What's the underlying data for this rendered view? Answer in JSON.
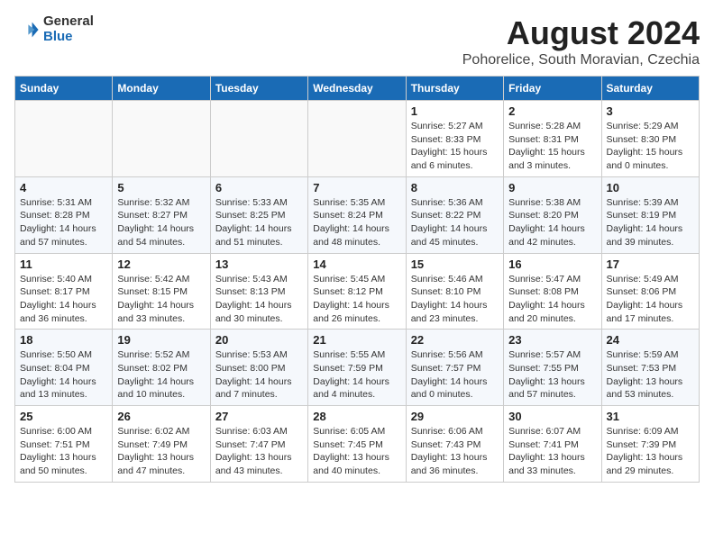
{
  "header": {
    "logo_line1": "General",
    "logo_line2": "Blue",
    "title": "August 2024",
    "subtitle": "Pohorelice, South Moravian, Czechia"
  },
  "days_of_week": [
    "Sunday",
    "Monday",
    "Tuesday",
    "Wednesday",
    "Thursday",
    "Friday",
    "Saturday"
  ],
  "weeks": [
    [
      {
        "day": "",
        "info": ""
      },
      {
        "day": "",
        "info": ""
      },
      {
        "day": "",
        "info": ""
      },
      {
        "day": "",
        "info": ""
      },
      {
        "day": "1",
        "info": "Sunrise: 5:27 AM\nSunset: 8:33 PM\nDaylight: 15 hours and 6 minutes."
      },
      {
        "day": "2",
        "info": "Sunrise: 5:28 AM\nSunset: 8:31 PM\nDaylight: 15 hours and 3 minutes."
      },
      {
        "day": "3",
        "info": "Sunrise: 5:29 AM\nSunset: 8:30 PM\nDaylight: 15 hours and 0 minutes."
      }
    ],
    [
      {
        "day": "4",
        "info": "Sunrise: 5:31 AM\nSunset: 8:28 PM\nDaylight: 14 hours and 57 minutes."
      },
      {
        "day": "5",
        "info": "Sunrise: 5:32 AM\nSunset: 8:27 PM\nDaylight: 14 hours and 54 minutes."
      },
      {
        "day": "6",
        "info": "Sunrise: 5:33 AM\nSunset: 8:25 PM\nDaylight: 14 hours and 51 minutes."
      },
      {
        "day": "7",
        "info": "Sunrise: 5:35 AM\nSunset: 8:24 PM\nDaylight: 14 hours and 48 minutes."
      },
      {
        "day": "8",
        "info": "Sunrise: 5:36 AM\nSunset: 8:22 PM\nDaylight: 14 hours and 45 minutes."
      },
      {
        "day": "9",
        "info": "Sunrise: 5:38 AM\nSunset: 8:20 PM\nDaylight: 14 hours and 42 minutes."
      },
      {
        "day": "10",
        "info": "Sunrise: 5:39 AM\nSunset: 8:19 PM\nDaylight: 14 hours and 39 minutes."
      }
    ],
    [
      {
        "day": "11",
        "info": "Sunrise: 5:40 AM\nSunset: 8:17 PM\nDaylight: 14 hours and 36 minutes."
      },
      {
        "day": "12",
        "info": "Sunrise: 5:42 AM\nSunset: 8:15 PM\nDaylight: 14 hours and 33 minutes."
      },
      {
        "day": "13",
        "info": "Sunrise: 5:43 AM\nSunset: 8:13 PM\nDaylight: 14 hours and 30 minutes."
      },
      {
        "day": "14",
        "info": "Sunrise: 5:45 AM\nSunset: 8:12 PM\nDaylight: 14 hours and 26 minutes."
      },
      {
        "day": "15",
        "info": "Sunrise: 5:46 AM\nSunset: 8:10 PM\nDaylight: 14 hours and 23 minutes."
      },
      {
        "day": "16",
        "info": "Sunrise: 5:47 AM\nSunset: 8:08 PM\nDaylight: 14 hours and 20 minutes."
      },
      {
        "day": "17",
        "info": "Sunrise: 5:49 AM\nSunset: 8:06 PM\nDaylight: 14 hours and 17 minutes."
      }
    ],
    [
      {
        "day": "18",
        "info": "Sunrise: 5:50 AM\nSunset: 8:04 PM\nDaylight: 14 hours and 13 minutes."
      },
      {
        "day": "19",
        "info": "Sunrise: 5:52 AM\nSunset: 8:02 PM\nDaylight: 14 hours and 10 minutes."
      },
      {
        "day": "20",
        "info": "Sunrise: 5:53 AM\nSunset: 8:00 PM\nDaylight: 14 hours and 7 minutes."
      },
      {
        "day": "21",
        "info": "Sunrise: 5:55 AM\nSunset: 7:59 PM\nDaylight: 14 hours and 4 minutes."
      },
      {
        "day": "22",
        "info": "Sunrise: 5:56 AM\nSunset: 7:57 PM\nDaylight: 14 hours and 0 minutes."
      },
      {
        "day": "23",
        "info": "Sunrise: 5:57 AM\nSunset: 7:55 PM\nDaylight: 13 hours and 57 minutes."
      },
      {
        "day": "24",
        "info": "Sunrise: 5:59 AM\nSunset: 7:53 PM\nDaylight: 13 hours and 53 minutes."
      }
    ],
    [
      {
        "day": "25",
        "info": "Sunrise: 6:00 AM\nSunset: 7:51 PM\nDaylight: 13 hours and 50 minutes."
      },
      {
        "day": "26",
        "info": "Sunrise: 6:02 AM\nSunset: 7:49 PM\nDaylight: 13 hours and 47 minutes."
      },
      {
        "day": "27",
        "info": "Sunrise: 6:03 AM\nSunset: 7:47 PM\nDaylight: 13 hours and 43 minutes."
      },
      {
        "day": "28",
        "info": "Sunrise: 6:05 AM\nSunset: 7:45 PM\nDaylight: 13 hours and 40 minutes."
      },
      {
        "day": "29",
        "info": "Sunrise: 6:06 AM\nSunset: 7:43 PM\nDaylight: 13 hours and 36 minutes."
      },
      {
        "day": "30",
        "info": "Sunrise: 6:07 AM\nSunset: 7:41 PM\nDaylight: 13 hours and 33 minutes."
      },
      {
        "day": "31",
        "info": "Sunrise: 6:09 AM\nSunset: 7:39 PM\nDaylight: 13 hours and 29 minutes."
      }
    ]
  ]
}
